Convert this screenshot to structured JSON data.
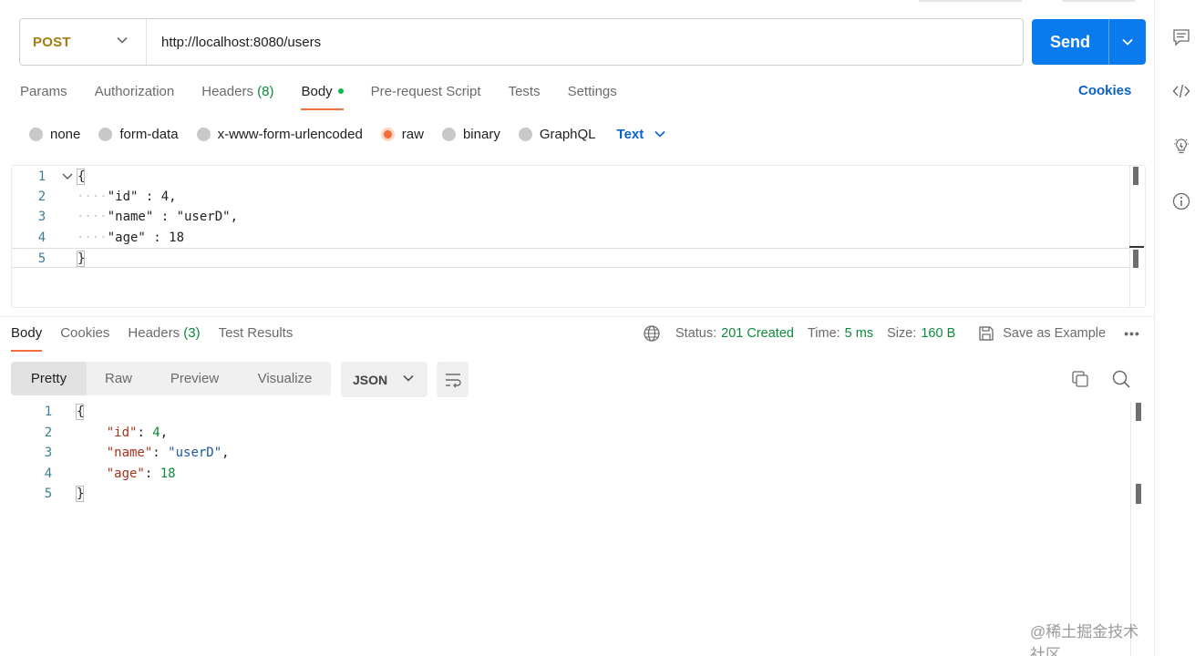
{
  "request": {
    "method": "POST",
    "url": "http://localhost:8080/users",
    "send_label": "Send"
  },
  "request_tabs": [
    {
      "label": "Params"
    },
    {
      "label": "Authorization"
    },
    {
      "label": "Headers",
      "count": "(8)"
    },
    {
      "label": "Body",
      "active": true,
      "dot": true
    },
    {
      "label": "Pre-request Script"
    },
    {
      "label": "Tests"
    },
    {
      "label": "Settings"
    }
  ],
  "cookies_link": "Cookies",
  "body_types": [
    {
      "label": "none",
      "checked": false
    },
    {
      "label": "form-data",
      "checked": false
    },
    {
      "label": "x-www-form-urlencoded",
      "checked": false
    },
    {
      "label": "raw",
      "checked": true
    },
    {
      "label": "binary",
      "checked": false
    },
    {
      "label": "GraphQL",
      "checked": false
    }
  ],
  "raw_format": "Text",
  "request_body": {
    "line_numbers": [
      "1",
      "2",
      "3",
      "4",
      "5"
    ],
    "lines": [
      "{",
      "\"id\" : 4,",
      "\"name\" : \"userD\",",
      "\"age\" : 18",
      "}"
    ]
  },
  "response_tabs": [
    {
      "label": "Body",
      "active": true
    },
    {
      "label": "Cookies"
    },
    {
      "label": "Headers",
      "count": "(3)"
    },
    {
      "label": "Test Results"
    }
  ],
  "response_meta": {
    "status_label": "Status:",
    "status_value": "201 Created",
    "time_label": "Time:",
    "time_value": "5 ms",
    "size_label": "Size:",
    "size_value": "160 B",
    "save_example": "Save as Example",
    "more": "•••"
  },
  "format_tabs": [
    "Pretty",
    "Raw",
    "Preview",
    "Visualize"
  ],
  "response_format": "JSON",
  "response_body": {
    "line_numbers": [
      "1",
      "2",
      "3",
      "4",
      "5"
    ],
    "open": "{",
    "id_key": "\"id\"",
    "id_value": "4",
    "name_key": "\"name\"",
    "name_value": "\"userD\"",
    "age_key": "\"age\"",
    "age_value": "18",
    "close": "}"
  },
  "right_rail_icons": [
    "comment-icon",
    "code-icon",
    "lightbulb-icon",
    "info-icon"
  ],
  "watermark": "@稀土掘金技术社区",
  "colors": {
    "accent": "#f26b3a",
    "send_blue": "#097bed",
    "link_blue": "#0b62c6",
    "method_post": "#a77a12",
    "status_green": "#0c8a3b"
  }
}
